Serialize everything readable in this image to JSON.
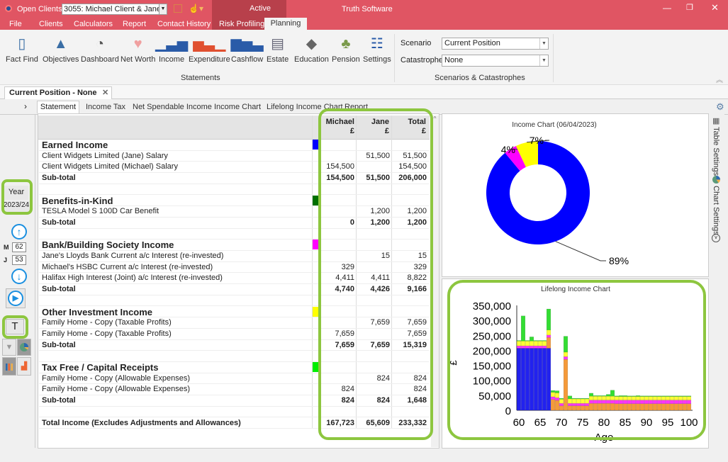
{
  "titlebar": {
    "open_clients_label": "Open Clients:",
    "client": "3055: Michael Client & Jane...",
    "active_label": "Active",
    "app_name": "Truth Software"
  },
  "menu": [
    "File",
    "Clients",
    "Calculators",
    "Report",
    "Contact History",
    "Risk Profiling",
    "Planning"
  ],
  "ribbon": {
    "items": [
      {
        "label": "Fact Find",
        "icon": "fact-find-icon"
      },
      {
        "label": "Objectives",
        "icon": "mountain-flag-icon"
      },
      {
        "label": "Dashboard",
        "icon": "gauge-icon"
      },
      {
        "label": "Net Worth",
        "icon": "piggy-bank-icon"
      },
      {
        "label": "Income",
        "icon": "income-chart-icon"
      },
      {
        "label": "Expenditure",
        "icon": "expenditure-chart-icon"
      },
      {
        "label": "Cashflow",
        "icon": "cashflow-chart-icon"
      },
      {
        "label": "Estate",
        "icon": "document-quill-icon"
      },
      {
        "label": "Education",
        "icon": "graduation-cap-icon"
      },
      {
        "label": "Pension",
        "icon": "coins-plant-icon"
      },
      {
        "label": "Settings",
        "icon": "sliders-icon"
      }
    ],
    "group_label": "Statements",
    "scenario_label": "Scenario",
    "scenario_value": "Current Position",
    "catastrophe_label": "Catastrophe",
    "catastrophe_value": "None",
    "group2_label": "Scenarios & Catastrophes"
  },
  "doc_tab": "Current Position - None",
  "subtabs": [
    "Statement",
    "Income Tax",
    "Net Spendable Income",
    "Income Chart",
    "Lifelong Income Chart",
    "Report"
  ],
  "sidebar": {
    "year_label": "Year",
    "year_value": "2023/24",
    "m_label": "M",
    "m_age": "62",
    "j_label": "J",
    "j_age": "53",
    "t_button": "T"
  },
  "table": {
    "columns": [
      "Michael\n£",
      "Jane\n£",
      "Total\n£"
    ],
    "col_names": [
      [
        "Michael",
        "£"
      ],
      [
        "Jane",
        "£"
      ],
      [
        "Total",
        "£"
      ]
    ],
    "rows": [
      {
        "type": "head",
        "label": "Earned Income",
        "color": "#0000ff"
      },
      {
        "type": "item",
        "label": "Client Widgets Limited (Jane) Salary",
        "m": "",
        "j": "51,500",
        "t": "51,500"
      },
      {
        "type": "item",
        "label": "Client Widgets Limited (Michael) Salary",
        "m": "154,500",
        "j": "",
        "t": "154,500"
      },
      {
        "type": "sub",
        "label": "Sub-total",
        "m": "154,500",
        "j": "51,500",
        "t": "206,000"
      },
      {
        "type": "blank"
      },
      {
        "type": "head",
        "label": "Benefits-in-Kind",
        "color": "#007000"
      },
      {
        "type": "item",
        "label": "TESLA Model S 100D Car Benefit",
        "m": "",
        "j": "1,200",
        "t": "1,200"
      },
      {
        "type": "sub",
        "label": "Sub-total",
        "m": "0",
        "j": "1,200",
        "t": "1,200"
      },
      {
        "type": "blank"
      },
      {
        "type": "head",
        "label": "Bank/Building Society Income",
        "color": "#ff00ff"
      },
      {
        "type": "item",
        "label": "Jane's Lloyds Bank Current a/c Interest (re-invested)",
        "m": "",
        "j": "15",
        "t": "15"
      },
      {
        "type": "item",
        "label": "Michael's HSBC Current a/c Interest (re-invested)",
        "m": "329",
        "j": "",
        "t": "329"
      },
      {
        "type": "item",
        "label": "Halifax High Interest (Joint) a/c Interest (re-invested)",
        "m": "4,411",
        "j": "4,411",
        "t": "8,822"
      },
      {
        "type": "sub",
        "label": "Sub-total",
        "m": "4,740",
        "j": "4,426",
        "t": "9,166"
      },
      {
        "type": "blank"
      },
      {
        "type": "head",
        "label": "Other Investment Income",
        "color": "#ffff00"
      },
      {
        "type": "item",
        "label": "Family Home - Copy (Taxable Profits)",
        "m": "",
        "j": "7,659",
        "t": "7,659"
      },
      {
        "type": "item",
        "label": "Family Home - Copy (Taxable Profits)",
        "m": "7,659",
        "j": "",
        "t": "7,659"
      },
      {
        "type": "sub",
        "label": "Sub-total",
        "m": "7,659",
        "j": "7,659",
        "t": "15,319"
      },
      {
        "type": "blank"
      },
      {
        "type": "head",
        "label": "Tax Free / Capital Receipts",
        "color": "#00ee00"
      },
      {
        "type": "item",
        "label": "Family Home - Copy (Allowable Expenses)",
        "m": "",
        "j": "824",
        "t": "824"
      },
      {
        "type": "item",
        "label": "Family Home - Copy (Allowable Expenses)",
        "m": "824",
        "j": "",
        "t": "824"
      },
      {
        "type": "sub",
        "label": "Sub-total",
        "m": "824",
        "j": "824",
        "t": "1,648"
      },
      {
        "type": "blank"
      },
      {
        "type": "total",
        "label": "Total Income (Excludes Adjustments and Allowances)",
        "m": "167,723",
        "j": "65,609",
        "t": "233,332"
      }
    ]
  },
  "right_bar": {
    "table_settings": "Table Settings",
    "chart_settings": "Chart Settings"
  },
  "chart_data": [
    {
      "type": "pie",
      "title": "Income Chart (06/04/2023)",
      "donut": true,
      "slices": [
        {
          "label": "89%",
          "value": 89,
          "color": "#0000ff"
        },
        {
          "label": "4%",
          "value": 4,
          "color": "#ff00ff"
        },
        {
          "label": "7%",
          "value": 7,
          "color": "#ffff00"
        }
      ]
    },
    {
      "type": "bar",
      "stacked": true,
      "title": "Lifelong Income Chart",
      "xlabel": "Age",
      "ylabel": "£",
      "ylim": [
        0,
        350000
      ],
      "yticks": [
        "0",
        "50,000",
        "100,000",
        "150,000",
        "200,000",
        "250,000",
        "300,000",
        "350,000"
      ],
      "xticks": [
        "60",
        "65",
        "70",
        "75",
        "80",
        "85",
        "90",
        "95",
        "100"
      ],
      "x": [
        60,
        61,
        62,
        63,
        64,
        65,
        66,
        67,
        68,
        69,
        70,
        71,
        72,
        73,
        74,
        75,
        76,
        77,
        78,
        79,
        80,
        81,
        82,
        83,
        84,
        85,
        86,
        87,
        88,
        89,
        90,
        91,
        92,
        93,
        94,
        95,
        96,
        97,
        98,
        99,
        100
      ],
      "series": [
        {
          "color": "#2222ee",
          "values": [
            207000,
            207000,
            207000,
            207000,
            207000,
            207000,
            207000,
            207000,
            0,
            0,
            0,
            0,
            0,
            0,
            0,
            0,
            0,
            0,
            0,
            0,
            0,
            0,
            0,
            0,
            0,
            0,
            0,
            0,
            0,
            0,
            0,
            0,
            0,
            0,
            0,
            0,
            0,
            0,
            0,
            0,
            0
          ]
        },
        {
          "color": "#f59a3a",
          "values": [
            0,
            0,
            0,
            0,
            0,
            0,
            0,
            36000,
            36000,
            33000,
            15000,
            170000,
            15000,
            15000,
            15000,
            15000,
            15000,
            23000,
            23000,
            23000,
            23000,
            23000,
            23000,
            22000,
            22000,
            22000,
            22000,
            22000,
            22000,
            22000,
            22000,
            22000,
            22000,
            22000,
            22000,
            22000,
            22000,
            22000,
            22000,
            22000,
            22000
          ]
        },
        {
          "color": "#ff33ff",
          "values": [
            8000,
            8000,
            8000,
            8000,
            8000,
            8000,
            8000,
            8000,
            9000,
            9000,
            8000,
            9000,
            8000,
            8000,
            8000,
            8000,
            8000,
            11000,
            11000,
            11000,
            11000,
            11000,
            11000,
            12000,
            12000,
            12000,
            12000,
            12000,
            12000,
            12000,
            12000,
            12000,
            12000,
            12000,
            12000,
            12000,
            12000,
            12000,
            12000,
            12000,
            12000
          ]
        },
        {
          "color": "#ffff33",
          "values": [
            16000,
            16000,
            16000,
            16000,
            16000,
            16000,
            16000,
            17000,
            15000,
            16000,
            14000,
            15000,
            15000,
            15000,
            15000,
            15000,
            15000,
            13000,
            13000,
            13000,
            13000,
            13000,
            13000,
            12000,
            12000,
            12000,
            12000,
            12000,
            12000,
            12000,
            12000,
            12000,
            12000,
            12000,
            12000,
            12000,
            12000,
            12000,
            12000,
            12000,
            12000
          ]
        },
        {
          "color": "#33dd33",
          "values": [
            2000,
            84000,
            2000,
            14000,
            2000,
            2000,
            2000,
            70000,
            6000,
            7000,
            3000,
            53000,
            10000,
            2000,
            2000,
            2000,
            2000,
            10000,
            2000,
            2000,
            2000,
            6000,
            20000,
            2000,
            3000,
            3000,
            2000,
            2000,
            3000,
            2000,
            2000,
            2000,
            2000,
            2000,
            2000,
            2000,
            2000,
            2000,
            2000,
            2000,
            2000
          ]
        }
      ]
    }
  ]
}
